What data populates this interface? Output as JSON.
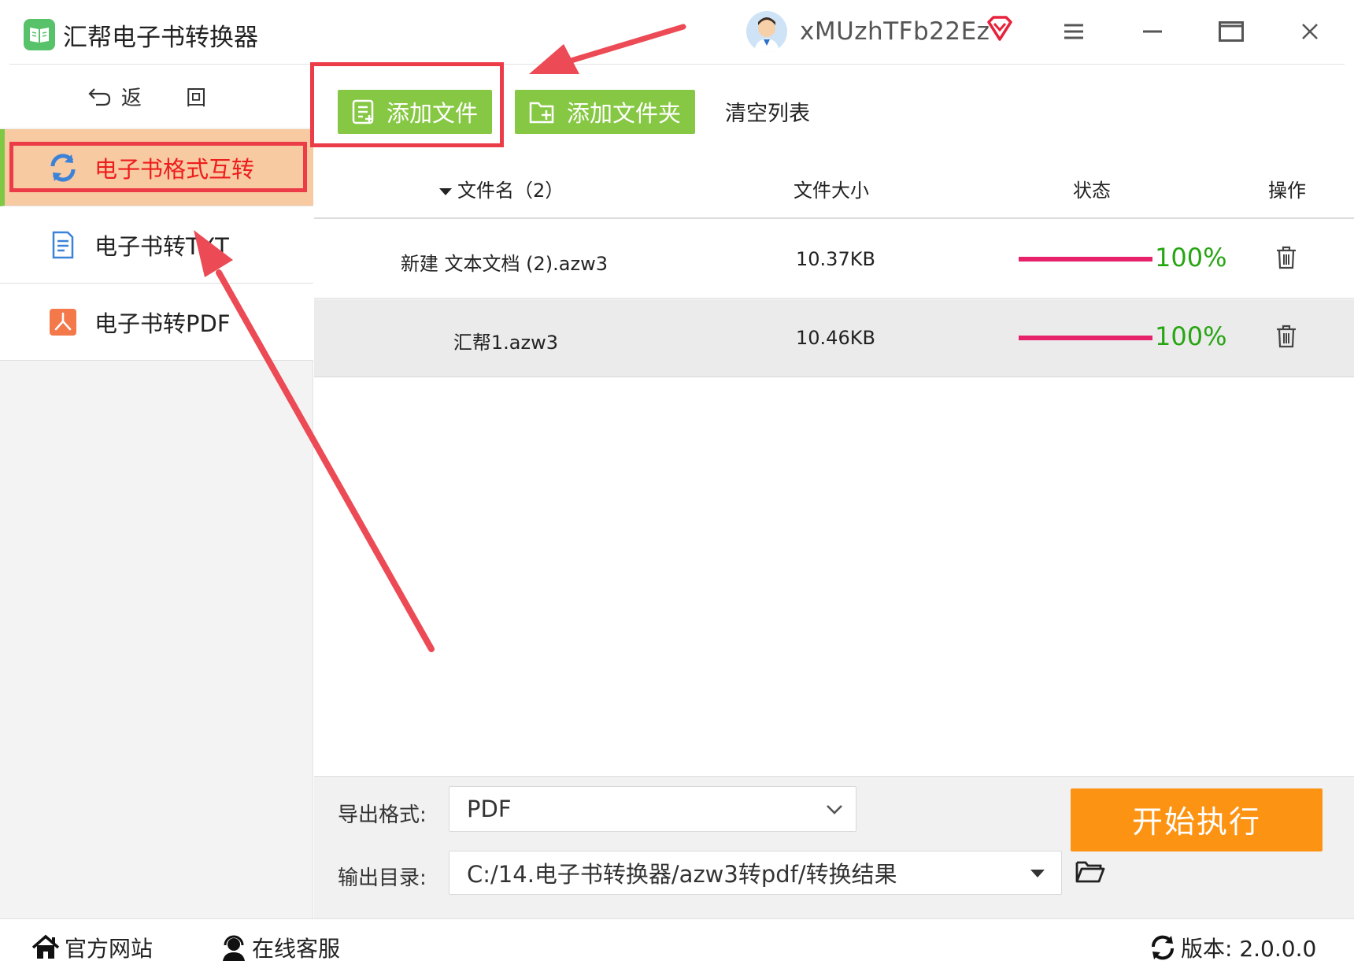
{
  "app": {
    "title": "汇帮电子书转换器",
    "username": "xMUzhTFb22Ez"
  },
  "sidebar": {
    "back_label": "返 回",
    "items": [
      {
        "label": "电子书格式互转",
        "active": true
      },
      {
        "label": "电子书转TXT",
        "active": false
      },
      {
        "label": "电子书转PDF",
        "active": false
      }
    ]
  },
  "toolbar": {
    "add_file": "添加文件",
    "add_folder": "添加文件夹",
    "clear_list": "清空列表"
  },
  "table": {
    "headers": {
      "name": "文件名（2）",
      "size": "文件大小",
      "status": "状态",
      "action": "操作"
    },
    "rows": [
      {
        "name": "新建 文本文档 (2).azw3",
        "size": "10.37KB",
        "progress": "100%"
      },
      {
        "name": "汇帮1.azw3",
        "size": "10.46KB",
        "progress": "100%"
      }
    ]
  },
  "export": {
    "format_label": "导出格式:",
    "format_value": "PDF",
    "dir_label": "输出目录:",
    "dir_value": "C:/14.电子书转换器/azw3转pdf/转换结果",
    "start_label": "开始执行"
  },
  "statusbar": {
    "website": "官方网站",
    "support": "在线客服",
    "version": "版本: 2.0.0.0"
  },
  "colors": {
    "accent_green": "#86c843",
    "start_orange": "#fd9312",
    "highlight_red": "#ec3c48",
    "progress_pink": "#e8226a",
    "progress_text_green": "#27a512",
    "active_nav_bg": "#f7caa2"
  }
}
